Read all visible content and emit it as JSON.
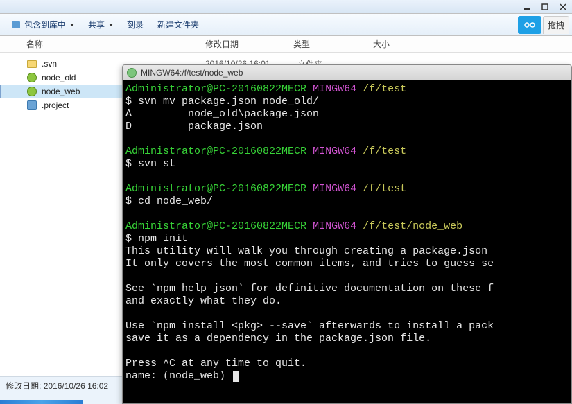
{
  "toolbar": {
    "include_lib": "包含到库中",
    "share": "共享",
    "burn": "刻录",
    "new_folder": "新建文件夹",
    "drag": "拖拽"
  },
  "columns": {
    "name": "名称",
    "date": "修改日期",
    "type": "类型",
    "size": "大小"
  },
  "files": [
    {
      "name": ".svn",
      "date": "2016/10/26 16:01",
      "type": "文件夹",
      "icon": "folder"
    },
    {
      "name": "node_old",
      "date": "",
      "type": "",
      "icon": "node"
    },
    {
      "name": "node_web",
      "date": "",
      "type": "",
      "icon": "node",
      "selected": true
    },
    {
      "name": ".project",
      "date": "",
      "type": "",
      "icon": "svn"
    }
  ],
  "status": {
    "date_label": "修改日期:",
    "date_value": "2016/10/26 16:02"
  },
  "terminal": {
    "title": "MINGW64:/f/test/node_web",
    "prompt_user": "Administrator@PC-20160822MECR",
    "prompt_shell": "MINGW64",
    "path1": "/f/test",
    "path2": "/f/test/node_web",
    "cmd1": "$ svn mv package.json node_old/",
    "out1a": "A         node_old\\package.json",
    "out1b": "D         package.json",
    "cmd2": "$ svn st",
    "cmd3": "$ cd node_web/",
    "cmd4": "$ npm init",
    "npm1": "This utility will walk you through creating a package.json ",
    "npm2": "It only covers the most common items, and tries to guess se",
    "npm3": "See `npm help json` for definitive documentation on these f",
    "npm4": "and exactly what they do.",
    "npm5": "Use `npm install <pkg> --save` afterwards to install a pack",
    "npm6": "save it as a dependency in the package.json file.",
    "npm7": "Press ^C at any time to quit.",
    "npm8": "name: (node_web) "
  }
}
